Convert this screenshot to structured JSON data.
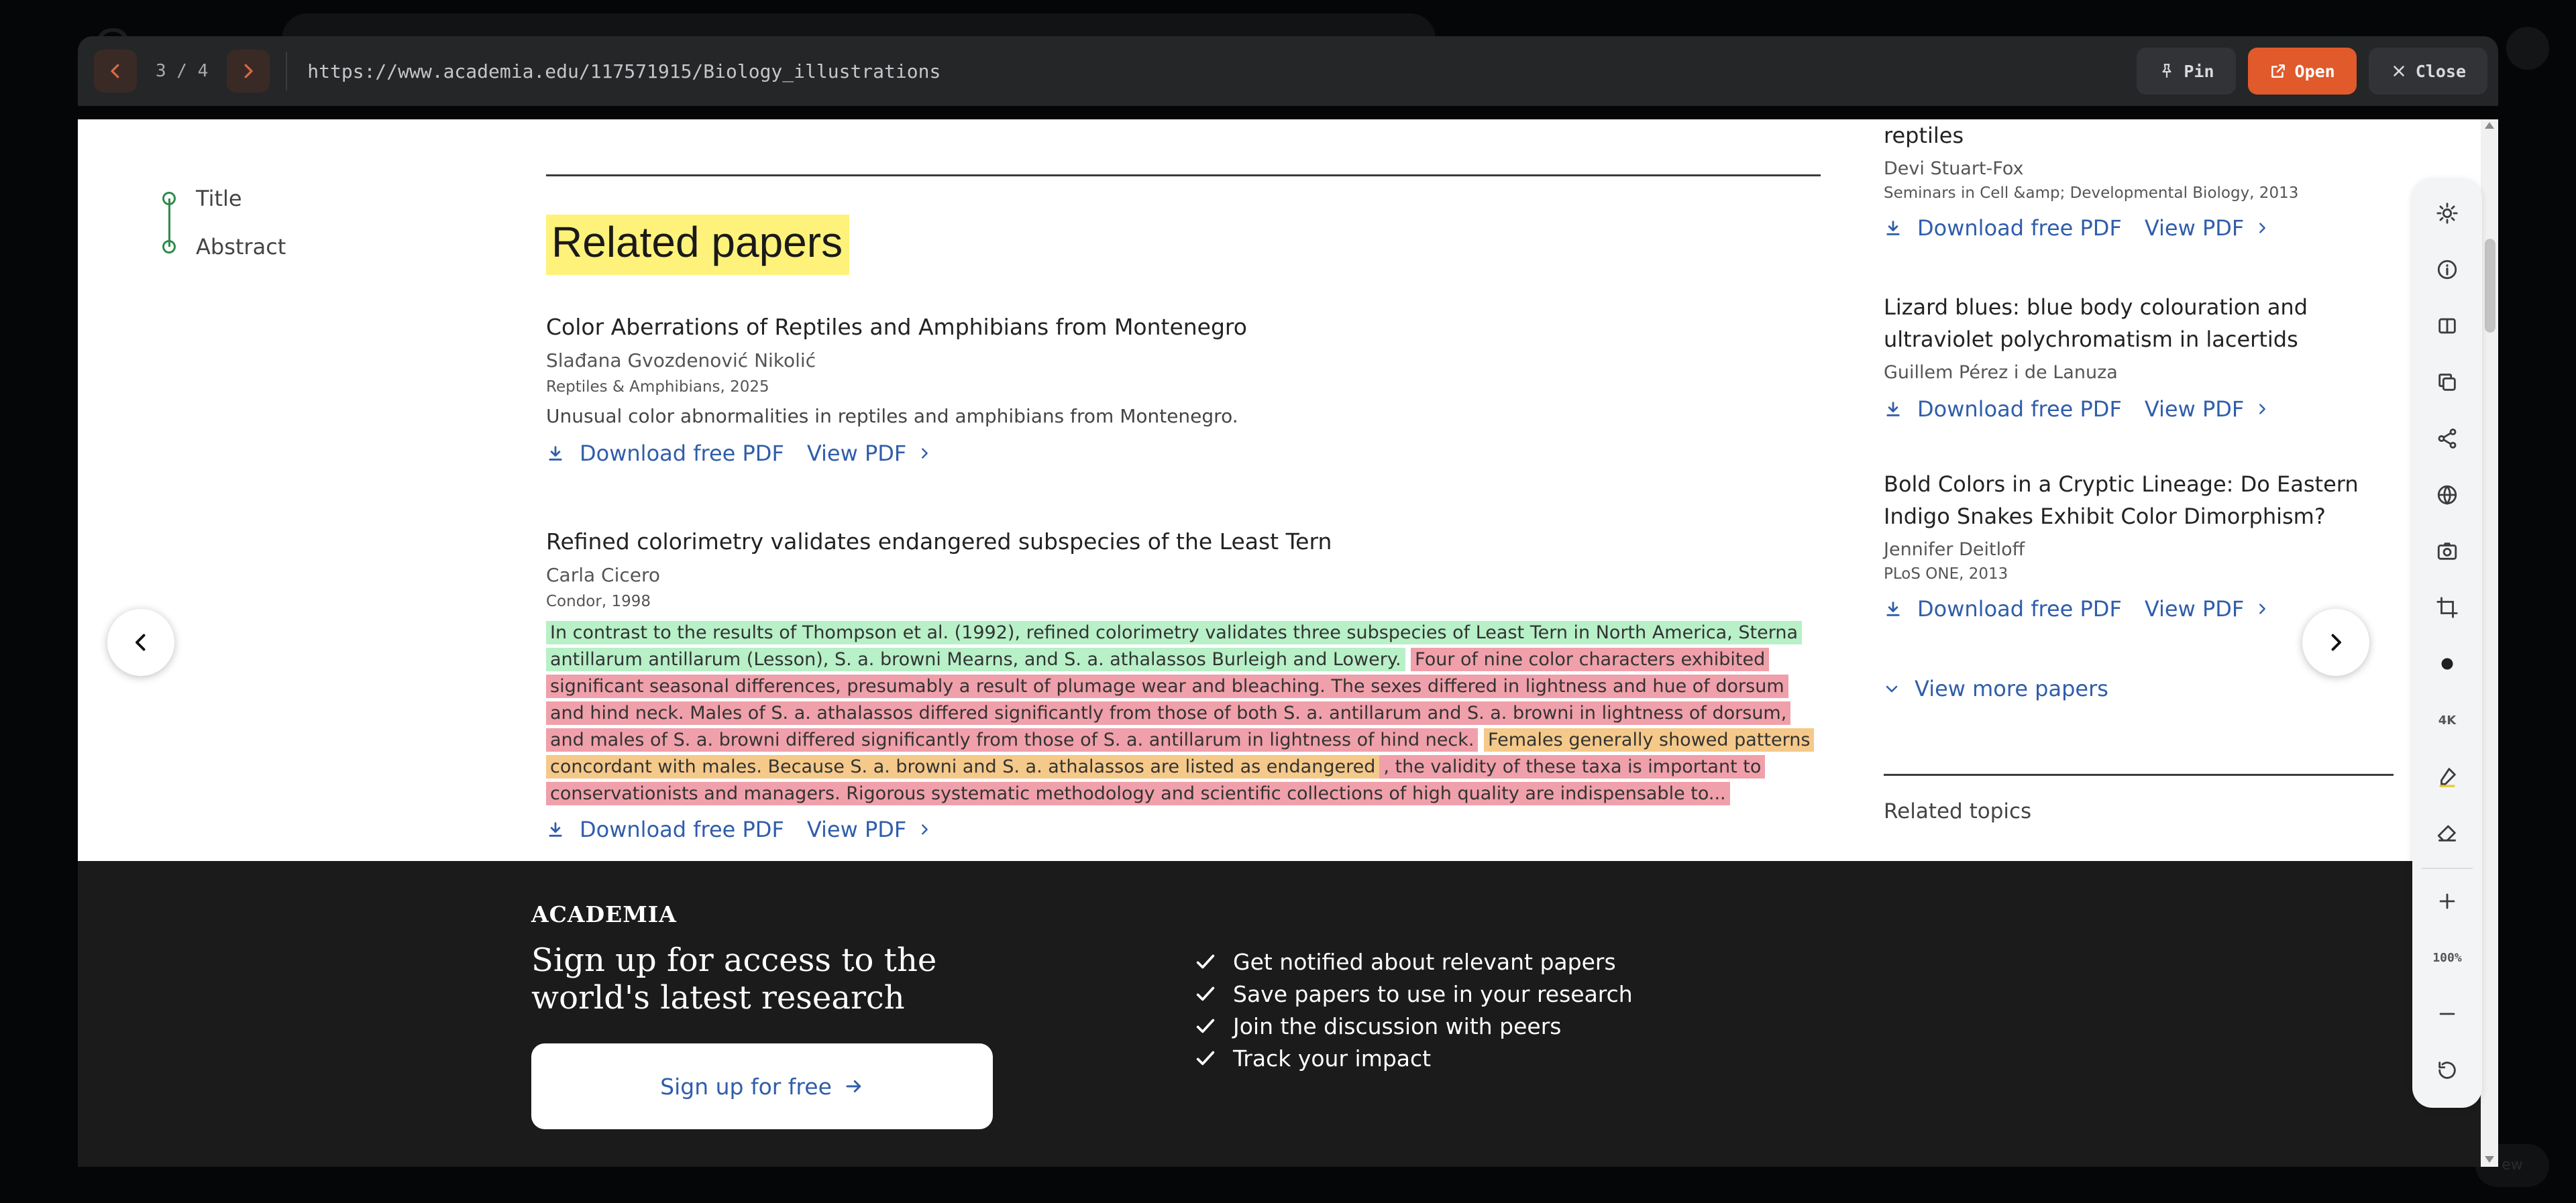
{
  "topbar": {
    "counter": "3 / 4",
    "url": "https://www.academia.edu/117571915/Biology_illustrations",
    "pin_label": "Pin",
    "open_label": "Open",
    "close_label": "Close"
  },
  "toc": {
    "items": [
      {
        "label": "Title"
      },
      {
        "label": "Abstract"
      }
    ]
  },
  "main": {
    "heading": "Related papers",
    "papers": [
      {
        "title": "Color Aberrations of Reptiles and Amphibians from Montenegro",
        "author": "Slađana Gvozdenović Nikolić",
        "venue": "Reptiles & Amphibians, 2025",
        "description": "Unusual color abnormalities in reptiles and amphibians from Montenegro.",
        "download_label": "Download free PDF",
        "view_label": "View PDF"
      },
      {
        "title": "Refined colorimetry validates endangered subspecies of the Least Tern",
        "author": "Carla Cicero",
        "venue": "Condor, 1998",
        "abstract": [
          {
            "text": "In contrast to the results of Thompson et al. (1992), refined colorimetry validates three subspecies of Least Tern in North America, Sterna antillarum antillarum (Lesson), S. a. browni Mearns, and S. a. athalassos Burleigh and Lowery.",
            "highlight": "green"
          },
          {
            "text": "Four of nine color characters exhibited significant seasonal differences, presumably a result of plumage wear and bleaching. The sexes differed in lightness and hue of dorsum and hind neck. Males of S. a. athalassos differed significantly from those of both S. a. antillarum and S. a. browni in lightness of dorsum, and males of S. a. browni differed significantly from those of S. a. antillarum in lightness of hind neck.",
            "highlight": "red"
          },
          {
            "text": "Females generally showed patterns concordant with males. Because S. a. browni and S. a. athalassos are listed as endangered",
            "highlight": "orange"
          },
          {
            "text": ", the validity of these taxa is important to conservationists and managers. Rigorous systematic methodology and scientific collections of high quality are indispensable to...",
            "highlight": "red"
          }
        ],
        "download_label": "Download free PDF",
        "view_label": "View PDF"
      }
    ]
  },
  "right": {
    "papers": [
      {
        "title": "reptiles",
        "author": "Devi Stuart-Fox",
        "venue": "Seminars in Cell &amp; Developmental Biology, 2013",
        "download_label": "Download free PDF",
        "view_label": "View PDF"
      },
      {
        "title": "Lizard blues: blue body colouration and ultraviolet polychromatism in lacertids",
        "author": "Guillem Pérez i de Lanuza",
        "download_label": "Download free PDF",
        "view_label": "View PDF"
      },
      {
        "title": "Bold Colors in a Cryptic Lineage: Do Eastern Indigo Snakes Exhibit Color Dimorphism?",
        "author": "Jennifer Deitloff",
        "venue": "PLoS ONE, 2013",
        "download_label": "Download free PDF",
        "view_label": "View PDF"
      }
    ],
    "view_more": "View more papers",
    "related_topics": "Related topics"
  },
  "toolbar": {
    "k4_label": "4K",
    "zoom_label": "100%"
  },
  "footer": {
    "logo": "ACADEMIA",
    "headline": "Sign up for access to the world's latest research",
    "signup_label": "Sign up for free",
    "bullets": [
      "Get notified about relevant papers",
      "Save papers to use in your research",
      "Join the discussion with peers",
      "Track your impact"
    ]
  },
  "colors": {
    "accent": "#e05a2b",
    "link": "#2f5daa",
    "heading_highlight": "#fff27a",
    "highlight_green": "#b8f0c8",
    "highlight_red": "#f0a0aa",
    "highlight_orange": "#f5c98a"
  }
}
